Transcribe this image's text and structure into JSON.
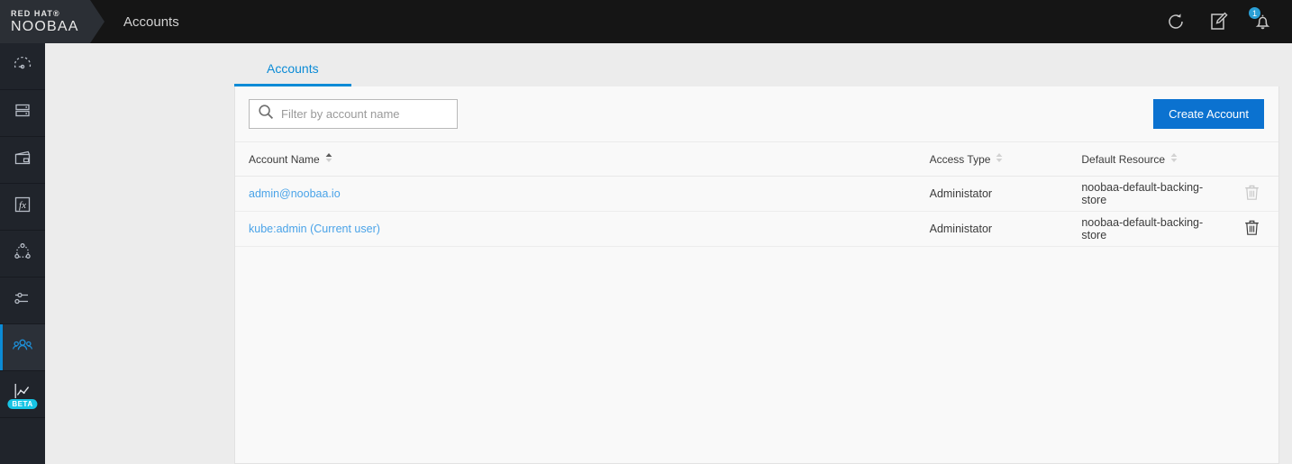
{
  "topbar": {
    "logo_top": "RED HAT®",
    "logo_bottom": "NOOBAA",
    "title": "Accounts",
    "icons": [
      {
        "name": "refresh-icon",
        "label": "Refresh"
      },
      {
        "name": "notes-icon",
        "label": "Notes"
      },
      {
        "name": "notifications-bell-icon",
        "label": "Notifications",
        "badge": "1"
      }
    ],
    "badge_color": "#2a9fd6"
  },
  "sidebar": {
    "items": [
      {
        "name": "overview",
        "icon": "gauge-icon",
        "active": false
      },
      {
        "name": "resources",
        "icon": "server-stack-icon",
        "active": false
      },
      {
        "name": "buckets",
        "icon": "bucket-icon",
        "active": false
      },
      {
        "name": "functions",
        "icon": "fx-icon",
        "active": false
      },
      {
        "name": "namespace",
        "icon": "nodes-graph-icon",
        "active": false
      },
      {
        "name": "settings",
        "icon": "sliders-icon",
        "active": false
      },
      {
        "name": "accounts",
        "icon": "people-icon",
        "active": true
      },
      {
        "name": "analytics",
        "icon": "analytics-chart-icon",
        "active": false,
        "badge": "BETA"
      }
    ],
    "active_color": "#0b8bd6",
    "beta_color": "#17c4e4"
  },
  "tabs": [
    {
      "label": "Accounts",
      "active": true
    }
  ],
  "toolbar": {
    "search_placeholder": "Filter by account name",
    "search_value": "",
    "create_label": "Create Account",
    "create_color": "#0b72d0"
  },
  "table": {
    "columns": [
      {
        "label": "Account Name",
        "sort": "asc"
      },
      {
        "label": "Access Type",
        "sort": "none"
      },
      {
        "label": "Default Resource",
        "sort": "none"
      }
    ],
    "rows": [
      {
        "account_name": "admin@noobaa.io",
        "access_type": "Administator",
        "default_resource": "noobaa-default-backing-store",
        "delete_enabled": false
      },
      {
        "account_name": "kube:admin (Current user)",
        "access_type": "Administator",
        "default_resource": "noobaa-default-backing-store",
        "delete_enabled": true
      }
    ]
  }
}
